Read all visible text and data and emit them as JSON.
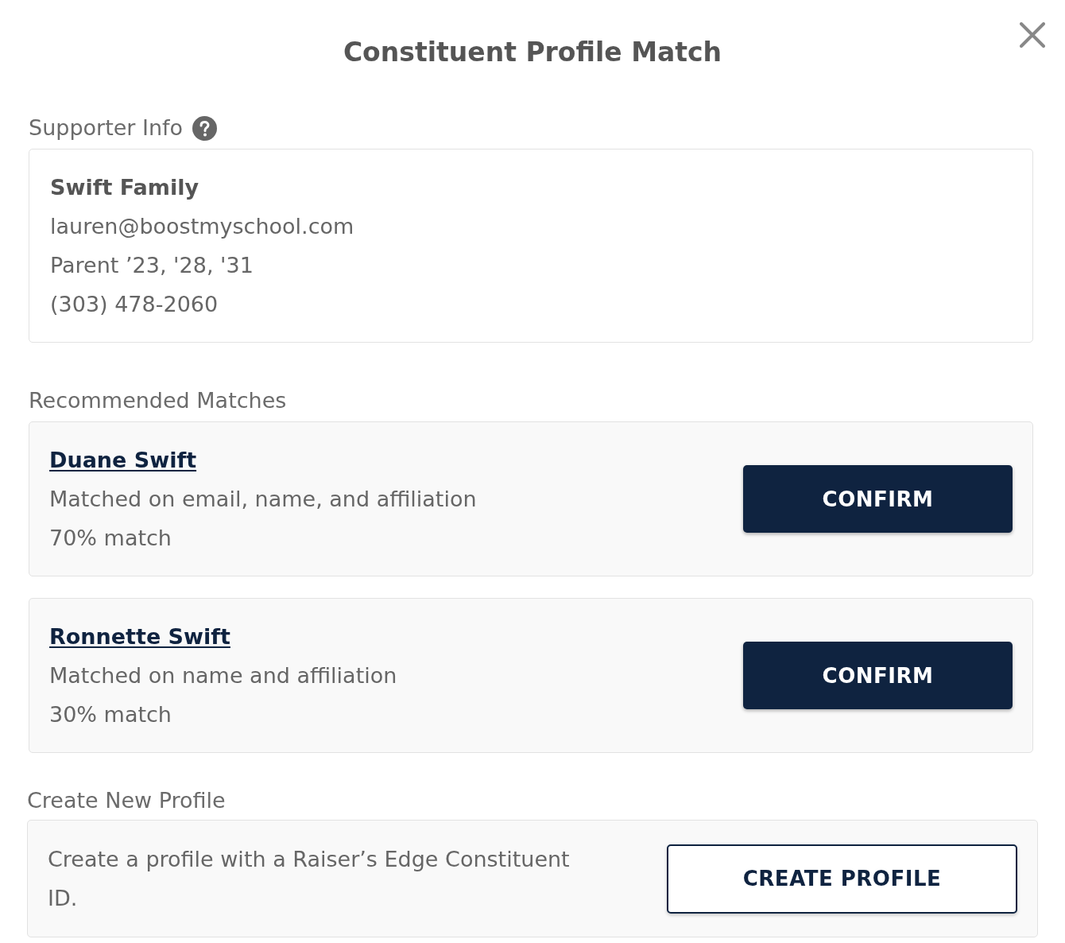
{
  "dialog": {
    "title": "Constituent Profile Match"
  },
  "supporter_info": {
    "label": "Supporter Info",
    "name": "Swift Family",
    "details": [
      "lauren@boostmyschool.com",
      "Parent ’23, '28, '31",
      "(303) 478-2060"
    ]
  },
  "recommended_matches": {
    "label": "Recommended Matches",
    "matches": [
      {
        "name": "Duane Swift",
        "reason": "Matched on email, name, and affiliation",
        "score": "70% match",
        "button": "CONFIRM"
      },
      {
        "name": "Ronnette Swift",
        "reason": "Matched on name and affiliation",
        "score": "30% match",
        "button": "CONFIRM"
      }
    ]
  },
  "create_new_profile": {
    "label": "Create New Profile",
    "description": "Create a profile with a Raiser’s Edge Constituent ID.",
    "button": "CREATE PROFILE"
  }
}
